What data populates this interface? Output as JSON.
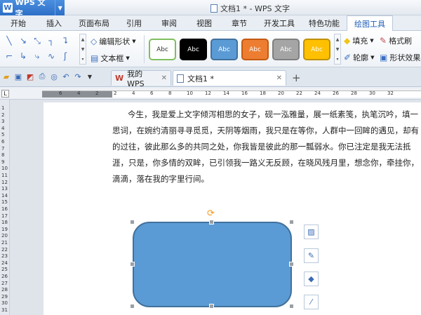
{
  "app": {
    "name": "WPS 文字",
    "window_title": "文档1 * - WPS 文字"
  },
  "tabs": [
    "开始",
    "插入",
    "页面布局",
    "引用",
    "审阅",
    "视图",
    "章节",
    "开发工具",
    "特色功能",
    "绘图工具"
  ],
  "active_tab": "绘图工具",
  "ribbon": {
    "edit_shape": "编辑形状",
    "text_box": "文本框",
    "style_label": "Abc",
    "fill": "填充",
    "format_brush": "格式刷",
    "outline": "轮廓",
    "shape_effects": "形状效果"
  },
  "style_presets": [
    {
      "bg": "#ffffff",
      "border": "#7fbf5f",
      "fg": "#333333"
    },
    {
      "bg": "#000000",
      "border": "#000000",
      "fg": "#ffffff"
    },
    {
      "bg": "#5b9bd5",
      "border": "#41719c",
      "fg": "#ffffff"
    },
    {
      "bg": "#ed7d31",
      "border": "#c55a11",
      "fg": "#ffffff"
    },
    {
      "bg": "#a5a5a5",
      "border": "#7f7f7f",
      "fg": "#ffffff"
    },
    {
      "bg": "#ffc000",
      "border": "#bf9000",
      "fg": "#ffffff"
    }
  ],
  "doc_tabs": [
    {
      "label": "我的WPS",
      "icon": "wps-icon"
    },
    {
      "label": "文档1 *",
      "icon": "document-icon"
    }
  ],
  "hruler_numbers": [
    "6",
    "4",
    "2",
    "2",
    "4",
    "6",
    "8",
    "10",
    "12",
    "14",
    "16",
    "18",
    "20",
    "22",
    "24",
    "26",
    "28",
    "30",
    "32"
  ],
  "vruler_numbers": [
    "1",
    "2",
    "3",
    "4",
    "5",
    "6",
    "7",
    "8",
    "9",
    "10",
    "11",
    "12",
    "13",
    "14",
    "15",
    "16",
    "17",
    "18",
    "19",
    "20",
    "21",
    "22",
    "23",
    "24",
    "25",
    "26",
    "27",
    "28",
    "29",
    "30",
    "31"
  ],
  "document": {
    "lines": [
      "今生，我是爱上文字倾泻相思的女子，砚一泓雅量，展一纸素笺，执笔沉吟，填一",
      "思词，在婉约清丽寻寻觅觅，天阴等烟雨，我只是在等你，人群中一回眸的遇见，却有",
      "的过往，彼此那么多的共同之处，你我皆是彼此的那一瓢弱水。你已注定是我无法抵",
      "涯，只是，你多情的双眸，已引领我一路义无反顾，在晓风残月里，想念你，牵挂你，",
      "滴滴，落在我的字里行间。"
    ]
  },
  "colors": {
    "accent": "#2d6fc6",
    "shape_fill": "#5b9bd5",
    "shape_border": "#41719c",
    "rotate_handle": "#f29a1a"
  }
}
